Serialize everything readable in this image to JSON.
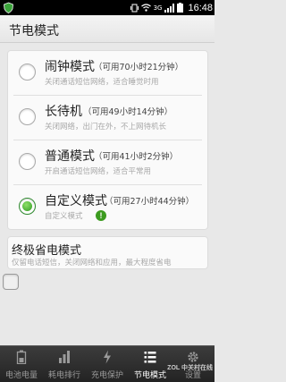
{
  "status_bar": {
    "time": "16:48",
    "network": "3G"
  },
  "header": {
    "title": "节电模式"
  },
  "modes": [
    {
      "name": "闹钟模式",
      "available": "（可用70小时21分钟）",
      "description": "关闭通话短信网络，适合睡觉时用",
      "selected": false
    },
    {
      "name": "长待机",
      "available": "（可用49小时14分钟）",
      "description": "关闭网络，出门在外，不上网待机长",
      "selected": false
    },
    {
      "name": "普通模式",
      "available": "（可用41小时2分钟）",
      "description": "开启通话短信网络，适合平常用",
      "selected": false
    },
    {
      "name": "自定义模式",
      "available": "（可用27小时44分钟）",
      "description": "自定义模式",
      "selected": true
    }
  ],
  "ultimate_mode": {
    "name": "终极省电模式",
    "description": "仅留电话短信，关闭网络和应用，最大程度省电"
  },
  "tabs": [
    {
      "label": "电池电量",
      "icon": "battery-icon",
      "active": false
    },
    {
      "label": "耗电排行",
      "icon": "ranking-icon",
      "active": false
    },
    {
      "label": "充电保护",
      "icon": "charge-bolt-icon",
      "active": false
    },
    {
      "label": "节电模式",
      "icon": "list-icon",
      "active": true
    },
    {
      "label": "设置",
      "icon": "gear-icon",
      "active": false
    }
  ],
  "watermark": "ZOL 中关村在线",
  "colors": {
    "accent_green": "#2e9a21",
    "tabbar_bg": "#2a2a2a",
    "background": "#e8e8e8"
  }
}
